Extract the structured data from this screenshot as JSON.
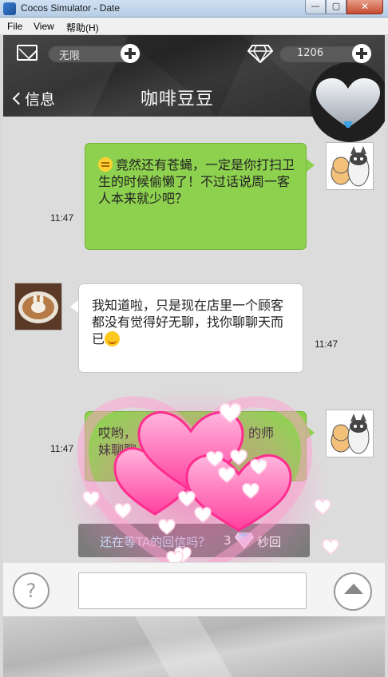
{
  "window": {
    "title": "Cocos Simulator - Date"
  },
  "menu": {
    "items": [
      "File",
      "View",
      "帮助(H)"
    ]
  },
  "header": {
    "energy_label": "无限",
    "diamond_count": "1206",
    "back_label": "信息",
    "chat_title": "咖啡豆豆"
  },
  "messages": [
    {
      "side": "right",
      "color": "green",
      "emoji": "neutral-emoji",
      "text": "竟然还有苍蝇，一定是你打扫卫生的时候偷懒了！不过话说周一客人本来就少吧？",
      "time": "11:47",
      "avatar": "cat-dog-avatar"
    },
    {
      "side": "left",
      "color": "white",
      "text": "我知道啦，只是现在店里一个顾客都没有觉得好无聊，找你聊聊天而已",
      "emoji": "smile-emoji",
      "time": "11:47",
      "avatar": "coffee-avatar"
    },
    {
      "side": "right",
      "color": "green",
      "text_part1": "哎哟，",
      "text_part2": "的师",
      "text_part3": "妹聊聊",
      "time": "11:47",
      "avatar": "cat-dog-avatar"
    }
  ],
  "infobar": {
    "text": "还在等TA的回信吗？",
    "count": "3",
    "suffix": "秒回"
  },
  "colors": {
    "green_bubble": "#8ed14f",
    "topbar": "#2e2e2e",
    "heart": "#ff6fb5"
  }
}
